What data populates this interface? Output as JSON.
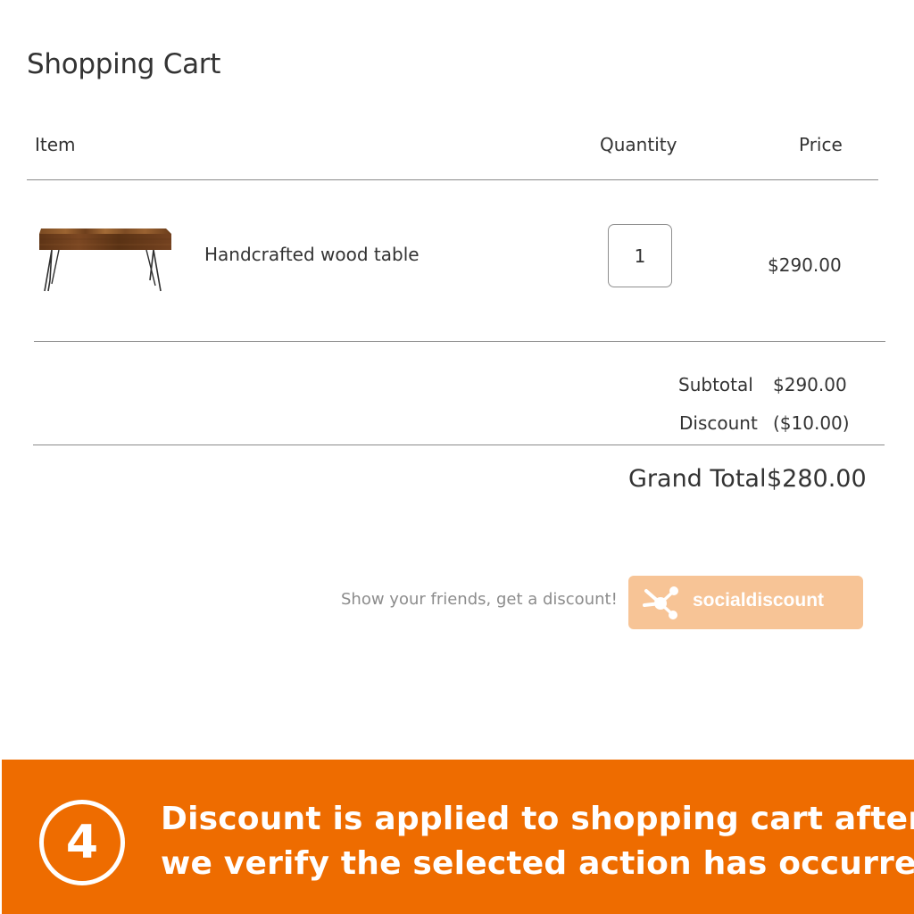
{
  "header": {
    "title": "Shopping Cart"
  },
  "table": {
    "columns": {
      "item": "Item",
      "quantity": "Quantity",
      "price": "Price"
    },
    "rows": [
      {
        "name": "Handcrafted wood table",
        "quantity": "1",
        "price": "$290.00",
        "image_icon": "wood-table-image"
      }
    ]
  },
  "summary": {
    "subtotal_label": "Subtotal",
    "subtotal_value": "$290.00",
    "discount_label": "Discount",
    "discount_value": "($10.00)",
    "grand_total_label": "Grand Total",
    "grand_total_value": "$280.00"
  },
  "promo": {
    "text": "Show your friends, get a discount!",
    "button_label": "socialdiscount",
    "button_icon": "share-icon",
    "button_color": "#f7c496"
  },
  "banner": {
    "step_number": "4",
    "line1": "Discount is applied to shopping cart after",
    "line2": "we verify the selected action has occurred",
    "color": "#ee6c00"
  }
}
